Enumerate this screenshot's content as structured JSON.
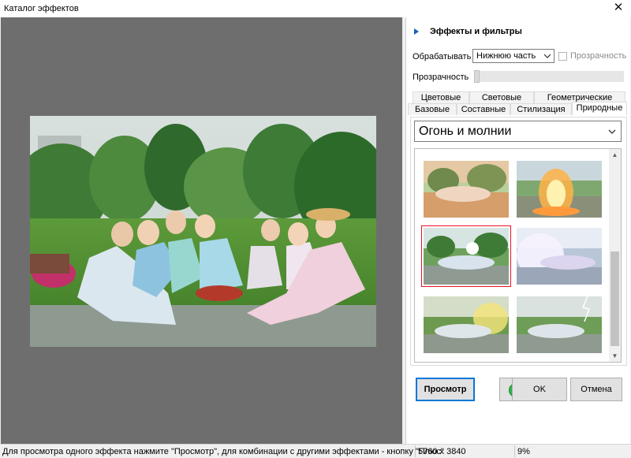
{
  "window": {
    "title": "Каталог эффектов"
  },
  "panel": {
    "heading": "Эффекты и фильтры",
    "process_label": "Обрабатывать",
    "process_value": "Нижнюю часть",
    "transparency_checkbox_label": "Прозрачность",
    "transparency_checkbox_checked": false,
    "transparency_slider_label": "Прозрачность",
    "transparency_value": 0,
    "tabs_row1": [
      "Цветовые",
      "Световые",
      "Геометрические"
    ],
    "tabs_row2": [
      "Базовые",
      "Составные",
      "Стилизация",
      "Природные"
    ],
    "active_tab": "Природные",
    "category": "Огонь и молнии",
    "thumbnails": [
      {
        "effect": "warm-sun",
        "selected": false
      },
      {
        "effect": "fire",
        "selected": false
      },
      {
        "effect": "sun-flare",
        "selected": true
      },
      {
        "effect": "white-glow",
        "selected": false
      },
      {
        "effect": "side-light",
        "selected": false
      },
      {
        "effect": "lightning",
        "selected": false
      }
    ]
  },
  "buttons": {
    "preview": "Просмотр",
    "ok": "OK",
    "cancel": "Отмена"
  },
  "status": {
    "hint": "Для просмотра одного эффекта нажмите \"Просмотр\", для комбинации с другими эффектами - кнопку \"Плюс\"",
    "dimensions": "5760 x 3840",
    "zoom": "9%"
  },
  "colors": {
    "preview_bg": "#6e6e6e",
    "accent": "#0078d7",
    "selection": "#e81123",
    "add_green": "#2fb34a"
  }
}
